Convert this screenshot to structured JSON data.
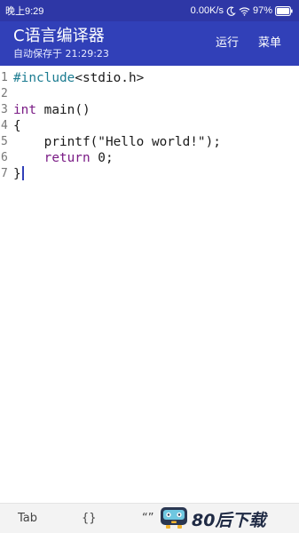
{
  "status_bar": {
    "time": "晚上9:29",
    "network_speed": "0.00K/s",
    "battery": "97%",
    "icons": [
      "moon-icon",
      "wifi-icon",
      "battery-icon"
    ]
  },
  "app_bar": {
    "title": "C语言编译器",
    "save_status": "自动保存于 21:29:23",
    "run_label": "运行",
    "menu_label": "菜单"
  },
  "editor": {
    "lines": [
      {
        "number": "1",
        "prefix": "",
        "keyword": "",
        "directive": "#include",
        "text": "<stdio.h>"
      },
      {
        "number": "2",
        "prefix": "",
        "keyword": "",
        "directive": "",
        "text": ""
      },
      {
        "number": "3",
        "prefix": "",
        "keyword": "int",
        "directive": "",
        "text": " main()"
      },
      {
        "number": "4",
        "prefix": "",
        "keyword": "",
        "directive": "",
        "text": "{"
      },
      {
        "number": "5",
        "prefix": "    ",
        "keyword": "",
        "directive": "",
        "text": "printf(\"Hello world!\");"
      },
      {
        "number": "6",
        "prefix": "    ",
        "keyword": "return",
        "directive": "",
        "text": " 0;"
      },
      {
        "number": "7",
        "prefix": "",
        "keyword": "",
        "directive": "",
        "text": "}"
      }
    ]
  },
  "toolbar": {
    "tab_label": "Tab",
    "brace_label": "{}",
    "quote_label": "“”"
  },
  "watermark": {
    "text": "80后下载"
  },
  "colors": {
    "status_bar": "#2e37a6",
    "app_bar": "#3140b8",
    "keyword": "#7a1b85",
    "directive": "#1c7c91"
  }
}
